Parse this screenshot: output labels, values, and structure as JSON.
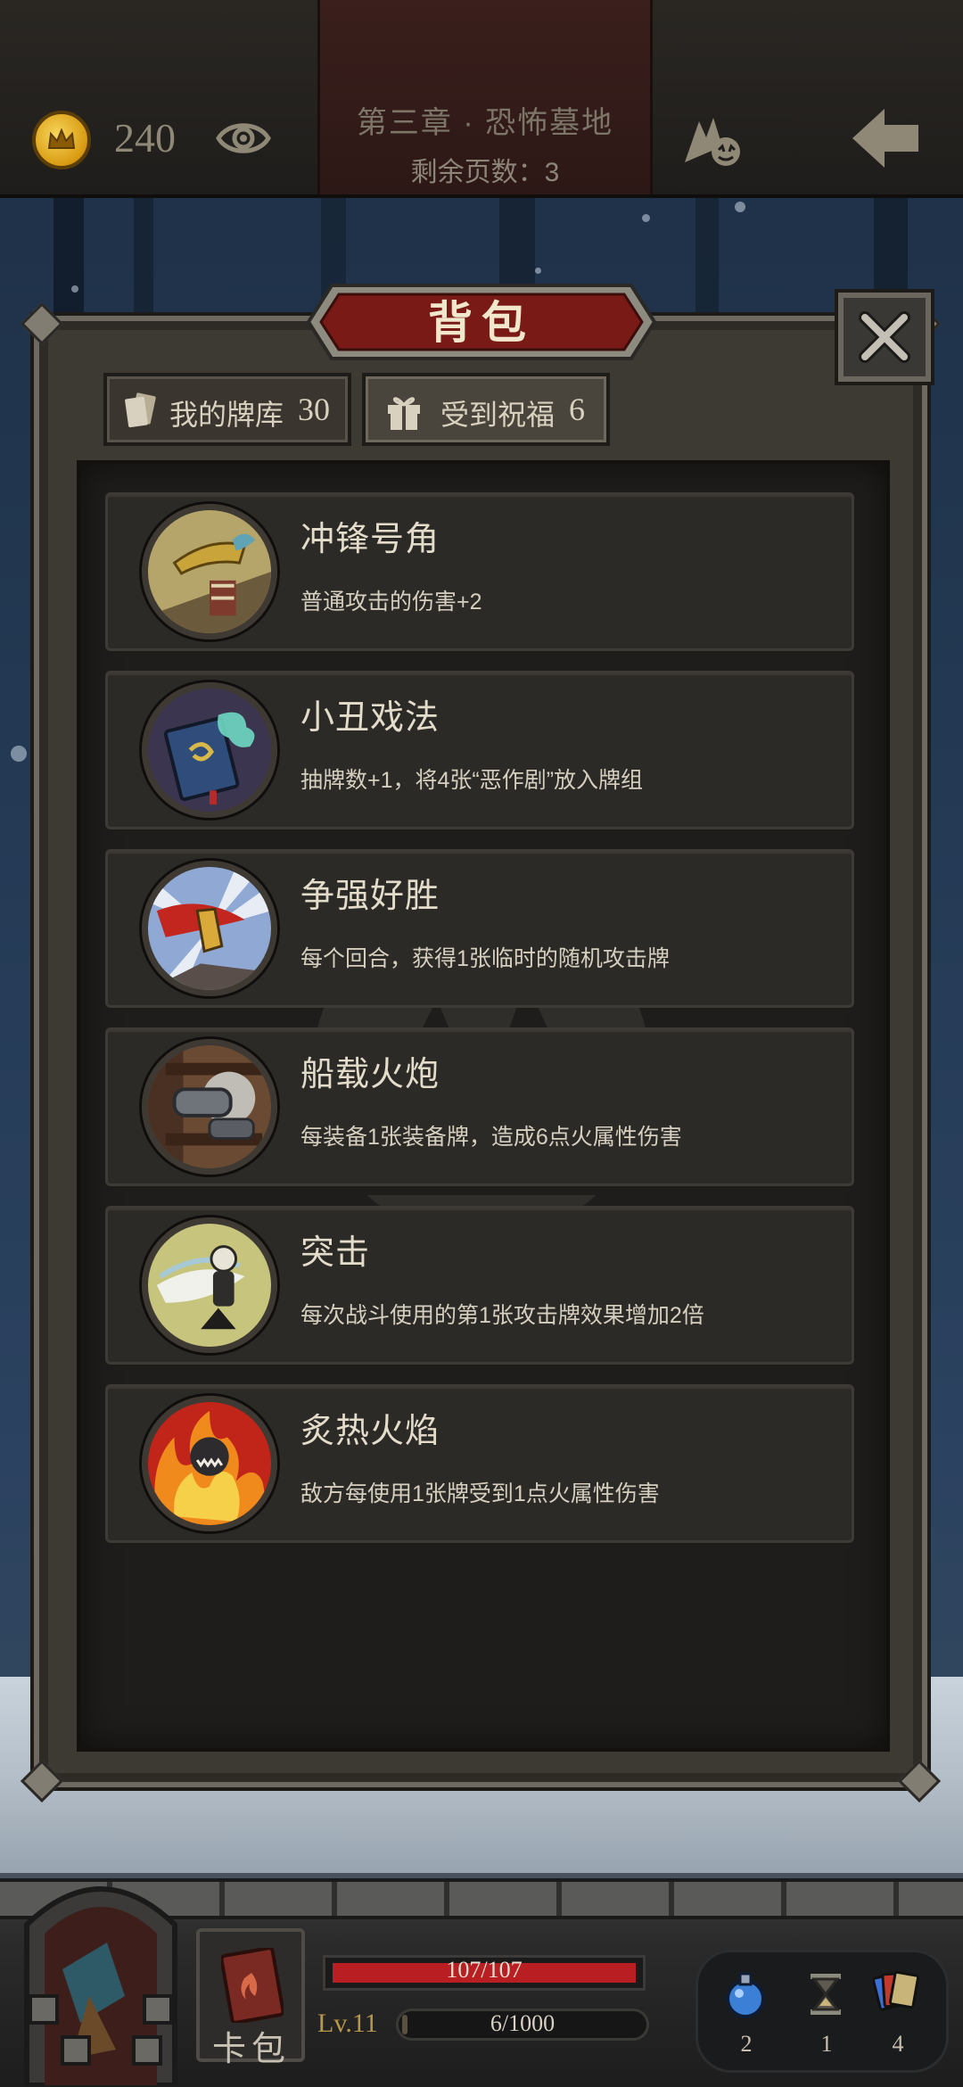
{
  "topbar": {
    "gold": "240",
    "chapter_title": "第三章 · 恐怖墓地",
    "pages_remaining": "剩余页数：3",
    "icons": {
      "coin": "crown-coin-icon",
      "eye": "eye-icon",
      "pet": "pet-icon",
      "back": "back-arrow-icon"
    }
  },
  "bag": {
    "title": "背包",
    "tabs": [
      {
        "label": "我的牌库",
        "count": "30",
        "icon": "card-deck-icon",
        "active": false
      },
      {
        "label": "受到祝福",
        "count": "6",
        "icon": "gift-icon",
        "active": true
      }
    ],
    "blessings": [
      {
        "name": "冲锋号角",
        "desc": "普通攻击的伤害+2",
        "icon": "horn-icon"
      },
      {
        "name": "小丑戏法",
        "desc": "抽牌数+1，将4张“恶作剧”放入牌组",
        "icon": "spellbook-icon"
      },
      {
        "name": "争强好胜",
        "desc": "每个回合，获得1张临时的随机攻击牌",
        "icon": "duelist-icon"
      },
      {
        "name": "船载火炮",
        "desc": "每装备1张装备牌，造成6点火属性伤害",
        "icon": "cannon-icon"
      },
      {
        "name": "突击",
        "desc": "每次战斗使用的第1张攻击牌效果增加2倍",
        "icon": "assault-icon"
      },
      {
        "name": "炙热火焰",
        "desc": "敌方每使用1张牌受到1点火属性伤害",
        "icon": "flame-icon"
      }
    ]
  },
  "hud": {
    "hp_text": "107/107",
    "hp": {
      "current": 107,
      "max": 107
    },
    "level": "Lv.11",
    "xp_text": "6/1000",
    "xp": {
      "current": 6,
      "max": 1000
    },
    "card_bag_label": "卡包",
    "resources": [
      {
        "icon": "potion-icon",
        "count": "2"
      },
      {
        "icon": "hourglass-icon",
        "count": "1"
      },
      {
        "icon": "cards-icon",
        "count": "4"
      }
    ]
  },
  "colors": {
    "hp_red": "#b81e22",
    "title_red": "#7a1a16",
    "text_light": "#e3dccb",
    "panel_dark": "#1e1d1b"
  }
}
